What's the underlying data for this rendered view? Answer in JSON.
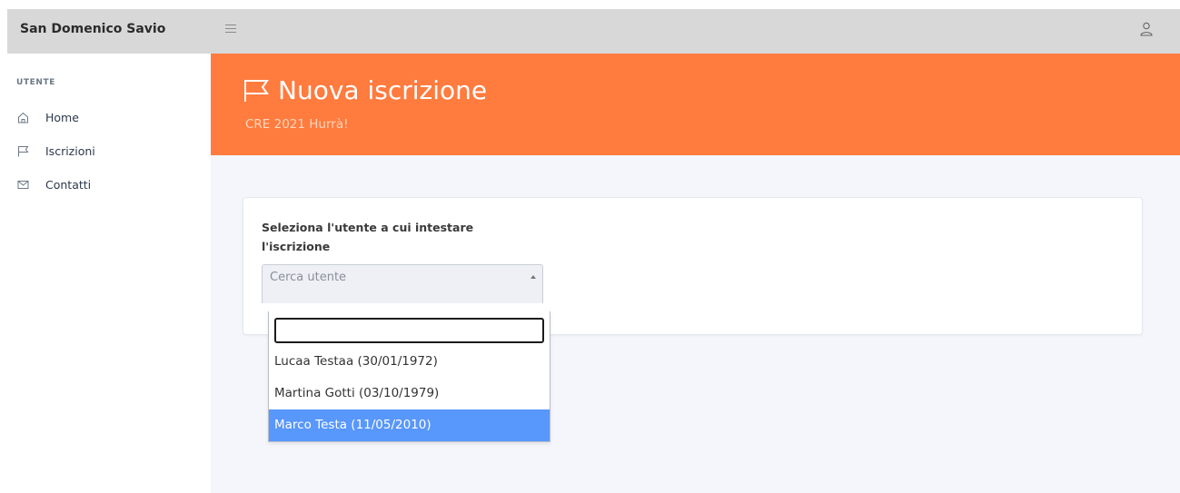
{
  "topbar": {
    "brand": "San Domenico Savio",
    "menu_icon": "hamburger-icon",
    "user_icon": "user-icon"
  },
  "sidebar": {
    "section_title": "UTENTE",
    "items": [
      {
        "label": "Home",
        "icon": "home-icon"
      },
      {
        "label": "Iscrizioni",
        "icon": "flag-icon"
      },
      {
        "label": "Contatti",
        "icon": "mail-icon"
      }
    ]
  },
  "hero": {
    "title": "Nuova iscrizione",
    "subtitle": "CRE 2021 Hurrà!",
    "icon": "flag-icon",
    "background": "#ff7b3e"
  },
  "form": {
    "label": "Seleziona l'utente a cui intestare l'iscrizione",
    "select_placeholder": "Cerca utente",
    "search_value": "",
    "options": [
      {
        "label": "Lucaa Testaa (30/01/1972)",
        "selected": false
      },
      {
        "label": "Martina Gotti (03/10/1979)",
        "selected": false
      },
      {
        "label": "Marco Testa (11/05/2010)",
        "selected": true
      }
    ],
    "selected_color": "#5897fb"
  }
}
